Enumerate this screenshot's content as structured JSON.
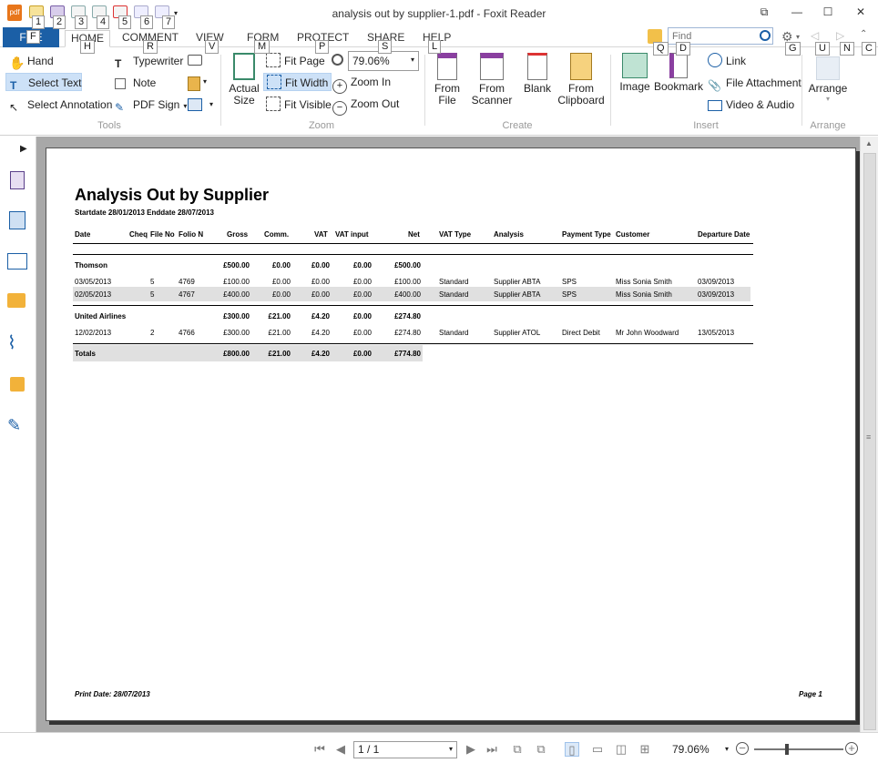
{
  "window": {
    "title": "analysis out by supplier-1.pdf - Foxit Reader",
    "logo_text": "pdf",
    "controls": [
      "⧉",
      "—",
      "☐",
      "✕"
    ]
  },
  "keytips": {
    "qat": [
      "1",
      "2",
      "3",
      "4",
      "5",
      "6",
      "7"
    ],
    "tabs": [
      "F",
      "H",
      "R",
      "V",
      "M",
      "P",
      "S",
      "L"
    ],
    "right": [
      "Q",
      "D",
      "G",
      "U",
      "N",
      "C"
    ]
  },
  "tabs": {
    "file": "FILE",
    "items": [
      "HOME",
      "COMMENT",
      "VIEW",
      "FORM",
      "PROTECT",
      "SHARE",
      "HELP"
    ],
    "active": "HOME"
  },
  "search": {
    "placeholder": "Find"
  },
  "ribbon": {
    "tools": {
      "label": "Tools",
      "hand": "Hand",
      "select_text": "Select Text",
      "select_annotation": "Select Annotation",
      "typewriter": "Typewriter",
      "note": "Note",
      "pdf_sign": "PDF Sign"
    },
    "zoom": {
      "label": "Zoom",
      "actual_size": "Actual Size",
      "fit_page": "Fit Page",
      "fit_width": "Fit Width",
      "fit_visible": "Fit Visible",
      "zoom_value": "79.06%",
      "zoom_in": "Zoom In",
      "zoom_out": "Zoom Out"
    },
    "create": {
      "label": "Create",
      "from_file": "From File",
      "from_scanner": "From Scanner",
      "blank": "Blank",
      "from_clipboard": "From Clipboard"
    },
    "insert": {
      "label": "Insert",
      "image": "Image",
      "bookmark": "Bookmark",
      "link": "Link",
      "file_attachment": "File Attachment",
      "video_audio": "Video & Audio"
    },
    "arrange": {
      "label": "Arrange",
      "arrange": "Arrange"
    }
  },
  "nav_icons": [
    "bookmark-panel-icon",
    "pages-panel-icon",
    "layers-panel-icon",
    "comments-panel-icon",
    "attachments-panel-icon",
    "security-panel-icon",
    "signatures-panel-icon"
  ],
  "report": {
    "title": "Analysis Out by Supplier",
    "subtitle": "Startdate 28/01/2013 Enddate 28/07/2013",
    "columns": [
      "Date",
      "Cheq",
      "File No",
      "Folio N",
      "Gross",
      "Comm.",
      "VAT",
      "VAT input",
      "Net",
      "VAT Type",
      "Analysis",
      "Payment Type",
      "Customer",
      "Departure Date"
    ],
    "groups": [
      {
        "name": "Thomson",
        "gross": "£500.00",
        "comm": "£0.00",
        "vat": "£0.00",
        "vat_input": "£0.00",
        "net": "£500.00",
        "rows": [
          {
            "date": "03/05/2013",
            "file": "5",
            "folio": "4769",
            "gross": "£100.00",
            "comm": "£0.00",
            "vat": "£0.00",
            "vat_input": "£0.00",
            "net": "£100.00",
            "vat_type": "Standard",
            "analysis": "Supplier ABTA",
            "payment": "SPS",
            "customer": "Miss Sonia Smith",
            "departure": "03/09/2013"
          },
          {
            "date": "02/05/2013",
            "file": "5",
            "folio": "4767",
            "gross": "£400.00",
            "comm": "£0.00",
            "vat": "£0.00",
            "vat_input": "£0.00",
            "net": "£400.00",
            "vat_type": "Standard",
            "analysis": "Supplier ABTA",
            "payment": "SPS",
            "customer": "Miss Sonia Smith",
            "departure": "03/09/2013"
          }
        ]
      },
      {
        "name": "United Airlines",
        "gross": "£300.00",
        "comm": "£21.00",
        "vat": "£4.20",
        "vat_input": "£0.00",
        "net": "£274.80",
        "rows": [
          {
            "date": "12/02/2013",
            "file": "2",
            "folio": "4766",
            "gross": "£300.00",
            "comm": "£21.00",
            "vat": "£4.20",
            "vat_input": "£0.00",
            "net": "£274.80",
            "vat_type": "Standard",
            "analysis": "Supplier ATOL",
            "payment": "Direct Debit",
            "customer": "Mr John Woodward",
            "departure": "13/05/2013"
          }
        ]
      }
    ],
    "totals": {
      "label": "Totals",
      "gross": "£800.00",
      "comm": "£21.00",
      "vat": "£4.20",
      "vat_input": "£0.00",
      "net": "£774.80"
    },
    "print_date": "Print Date: 28/07/2013",
    "page_label": "Page 1"
  },
  "status": {
    "page_indicator": "1 / 1",
    "zoom": "79.06%",
    "zoom_fraction": 0.36
  },
  "colors": {
    "file_tab": "#1b5fa6",
    "selected_button": "#cde1f7",
    "doc_background": "#a8a8a8"
  }
}
